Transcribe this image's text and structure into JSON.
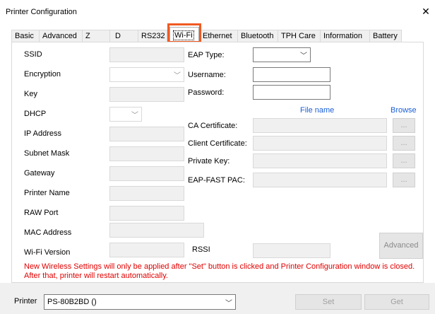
{
  "window": {
    "title": "Printer Configuration",
    "close_glyph": "✕"
  },
  "tabs": [
    {
      "label": "Basic"
    },
    {
      "label": "Advanced"
    },
    {
      "label": "Z"
    },
    {
      "label": "D"
    },
    {
      "label": "RS232"
    },
    {
      "label": "Wi-Fi"
    },
    {
      "label": "Ethernet"
    },
    {
      "label": "Bluetooth"
    },
    {
      "label": "TPH Care"
    },
    {
      "label": "Information"
    },
    {
      "label": "Battery"
    }
  ],
  "left_fields": {
    "ssid": "SSID",
    "encryption": "Encryption",
    "key": "Key",
    "dhcp": "DHCP",
    "ip_address": "IP Address",
    "subnet_mask": "Subnet Mask",
    "gateway": "Gateway",
    "printer_name": "Printer Name",
    "raw_port": "RAW Port",
    "mac_address": "MAC Address",
    "wifi_version": "Wi-Fi Version"
  },
  "right_fields": {
    "eap_type": "EAP Type:",
    "username": "Username:",
    "password": "Password:",
    "file_name_header": "File name",
    "browse_header": "Browse",
    "ca_certificate": "CA Certificate:",
    "client_certificate": "Client Certificate:",
    "private_key": "Private Key:",
    "eap_fast_pac": "EAP-FAST PAC:",
    "browse_button": "...",
    "rssi": "RSSI",
    "advanced_button": "Advanced"
  },
  "notice": "New Wireless Settings will only be applied after \"Set\" button is clicked and Printer Configuration window is closed. After that, printer will restart automatically.",
  "footer": {
    "printer_label": "Printer",
    "printer_value": "PS-80B2BD ()",
    "set_button": "Set",
    "get_button": "Get"
  },
  "colors": {
    "highlight": "#f05a22",
    "notice": "#e00000",
    "link_header": "#1a5fd6"
  }
}
